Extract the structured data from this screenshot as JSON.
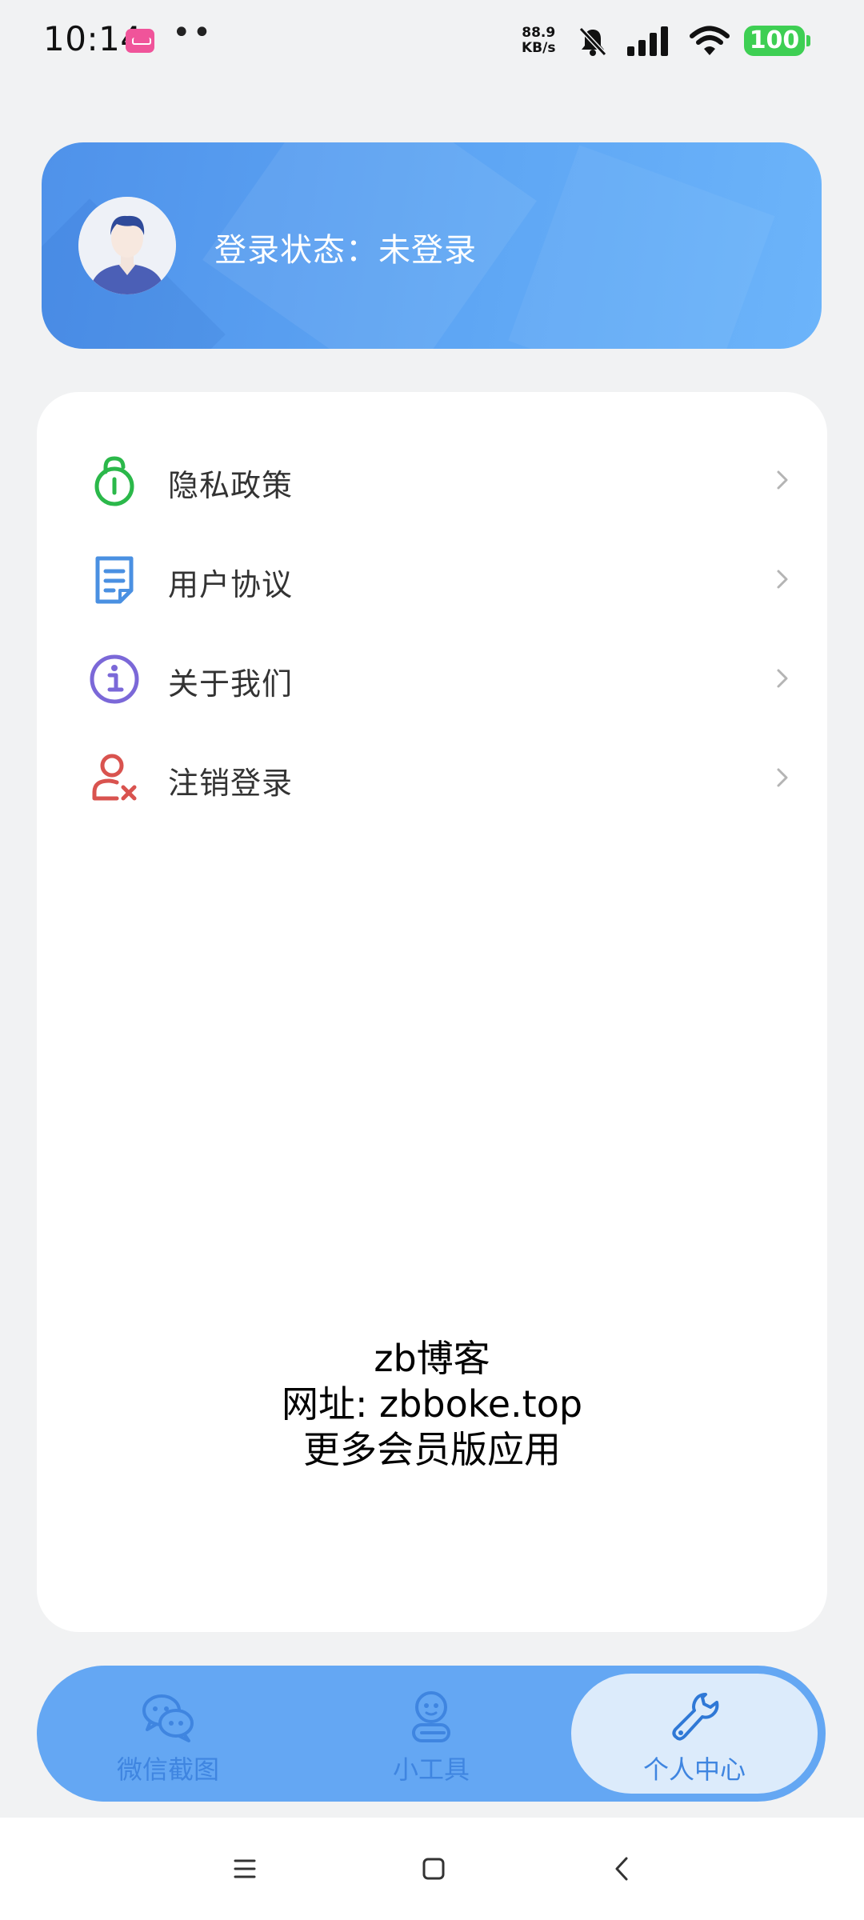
{
  "status_bar": {
    "time": "10:14",
    "dots": "••",
    "net_speed_value": "88.9",
    "net_speed_unit": "KB/s",
    "battery": "100"
  },
  "profile": {
    "login_status": "登录状态：未登录"
  },
  "menu": {
    "items": [
      {
        "label": "隐私政策",
        "icon": "privacy-lock-icon",
        "color": "#2bb84a"
      },
      {
        "label": "用户协议",
        "icon": "document-icon",
        "color": "#4a90e2"
      },
      {
        "label": "关于我们",
        "icon": "info-icon",
        "color": "#7b68d8"
      },
      {
        "label": "注销登录",
        "icon": "user-remove-icon",
        "color": "#d9534f"
      }
    ]
  },
  "promo": {
    "line1": "zb博客",
    "line2": "网址: zbboke.top",
    "line3": "更多会员版应用"
  },
  "tab_bar": {
    "tabs": [
      {
        "label": "微信截图",
        "icon": "wechat-icon"
      },
      {
        "label": "小工具",
        "icon": "robot-icon"
      },
      {
        "label": "个人中心",
        "icon": "wrench-icon",
        "active": true
      }
    ]
  },
  "colors": {
    "card_gradient_start": "#4f92ea",
    "card_gradient_end": "#6cb4fa",
    "tab_bar": "#64a7f3",
    "tab_active": "#dcebfb",
    "tab_label": "#3f85e0",
    "battery": "#3ecf53"
  }
}
